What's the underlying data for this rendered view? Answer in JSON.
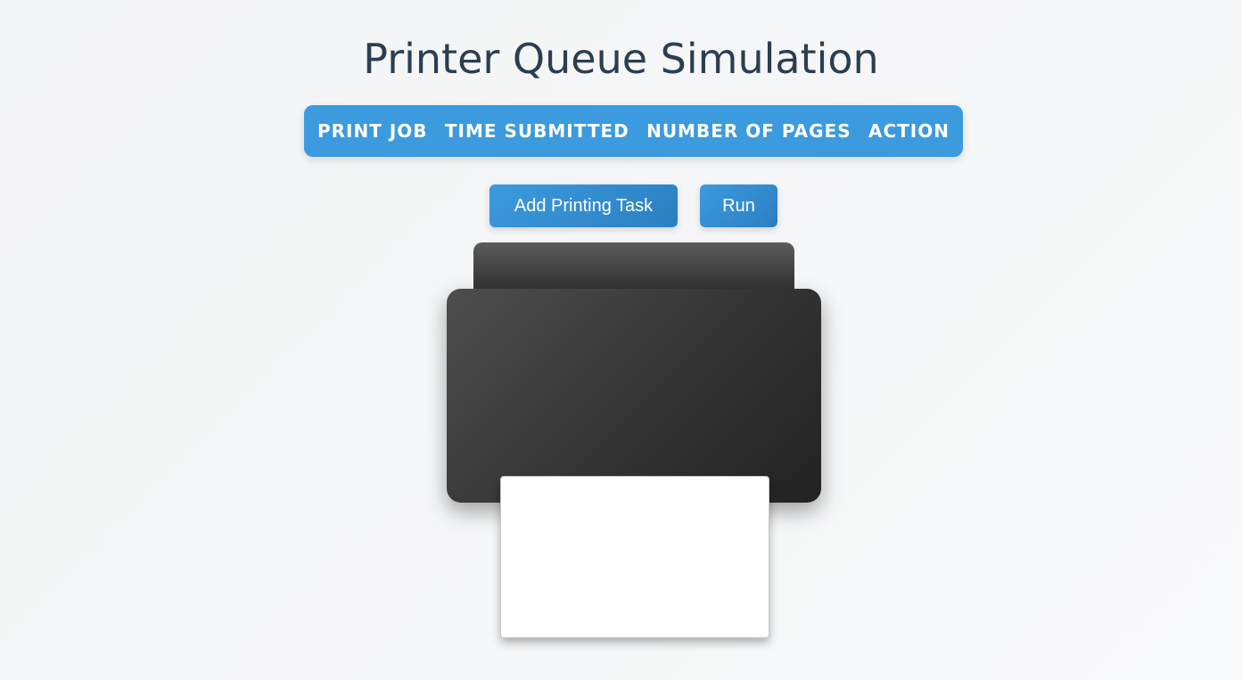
{
  "page": {
    "title": "Printer Queue Simulation"
  },
  "queue_table": {
    "columns": [
      "Print Job",
      "Time Submitted",
      "Number of Pages",
      "Action"
    ],
    "rows": []
  },
  "controls": {
    "add_task_label": "Add Printing Task",
    "run_label": "Run"
  },
  "printer": {
    "paper_visible": true
  },
  "colors": {
    "accent": "#3c9ade",
    "title_text": "#2c3e50",
    "printer_dark": "#2b2b2b",
    "paper": "#ffffff"
  }
}
